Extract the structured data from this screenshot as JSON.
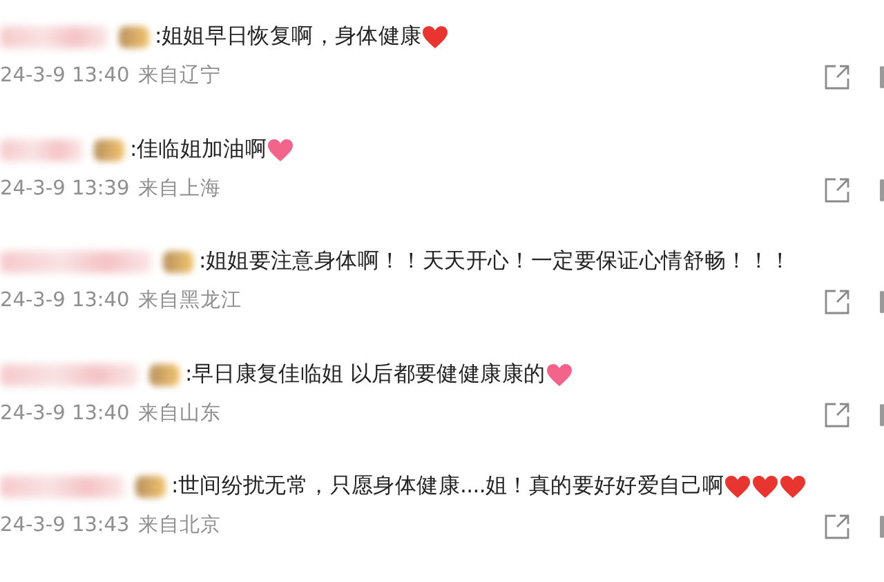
{
  "comments": [
    {
      "text": ":姐姐早日恢复啊，身体健康",
      "emojis": [
        {
          "kind": "heart",
          "color": "#e8352f"
        }
      ],
      "time": "24-3-9 13:40",
      "location": "来自辽宁"
    },
    {
      "text": ":佳临姐加油啊",
      "emojis": [
        {
          "kind": "heart",
          "color": "#f2648a"
        }
      ],
      "time": "24-3-9 13:39",
      "location": "来自上海"
    },
    {
      "text": ":姐姐要注意身体啊！！天天开心！一定要保证心情舒畅！！！",
      "time": "24-3-9 13:40",
      "location": "来自黑龙江"
    },
    {
      "text": ":早日康复佳临姐 以后都要健健康康的",
      "emojis": [
        {
          "kind": "heart",
          "color": "#f2648a"
        }
      ],
      "time": "24-3-9 13:40",
      "location": "来自山东"
    },
    {
      "text": ":世间纷扰无常，只愿身体健康....姐！真的要好好爱自己啊",
      "emojis": [
        {
          "kind": "heart",
          "color": "#e8352f"
        },
        {
          "kind": "heart",
          "color": "#e8352f"
        },
        {
          "kind": "heart",
          "color": "#e8352f"
        }
      ],
      "time": "24-3-9 13:43",
      "location": "来自北京"
    }
  ]
}
